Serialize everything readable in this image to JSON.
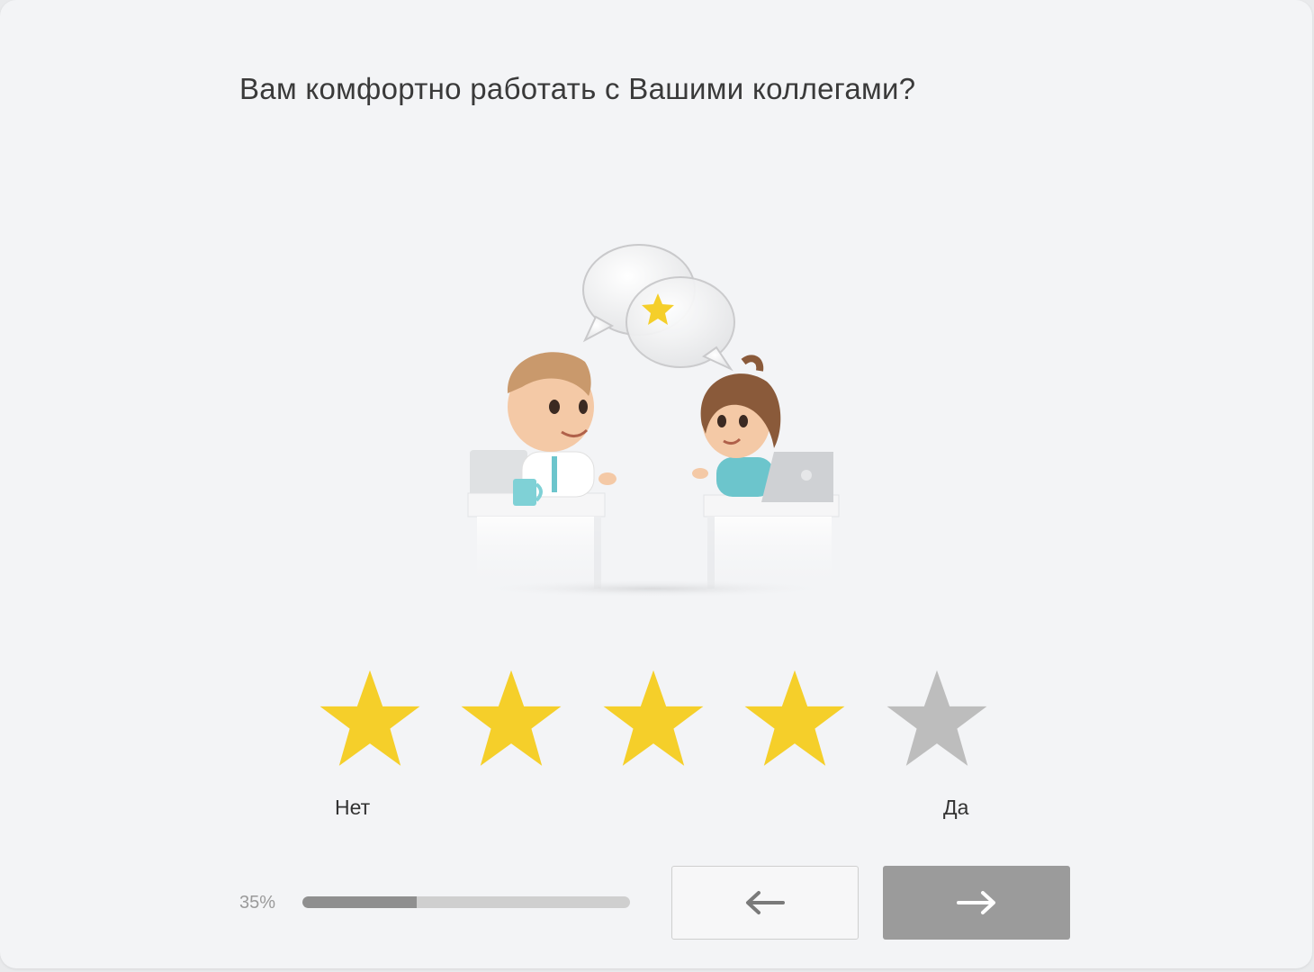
{
  "question": {
    "text": "Вам комфортно работать с Вашими коллегами?"
  },
  "illustration": {
    "description_icon": "colleagues-chat-illustration"
  },
  "rating": {
    "max": 5,
    "value": 4,
    "filled_color": "#f5cf2a",
    "empty_color": "#bdbdbd",
    "label_min": "Нет",
    "label_max": "Да"
  },
  "progress": {
    "percent_text": "35%",
    "value": 0.35
  },
  "navigation": {
    "back_icon": "arrow-left-icon",
    "next_icon": "arrow-right-icon"
  }
}
